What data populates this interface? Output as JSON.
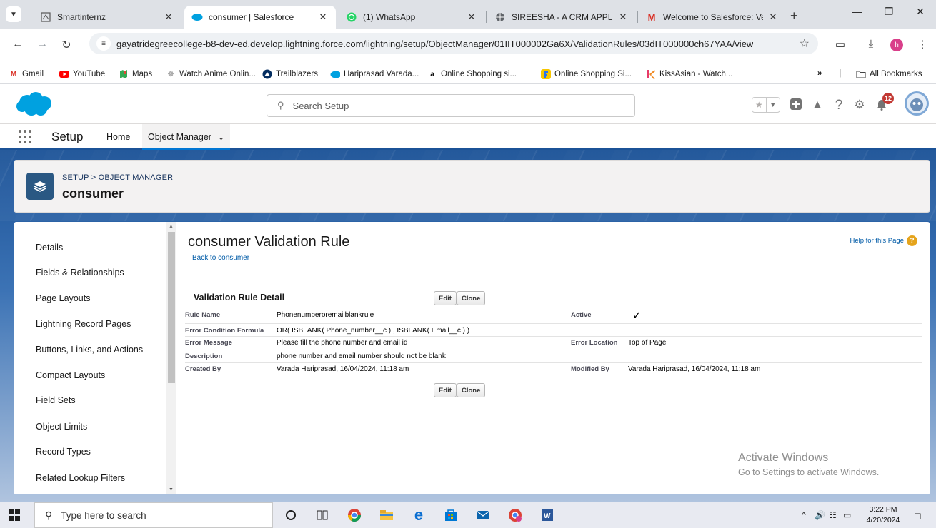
{
  "browser": {
    "tabs": [
      {
        "title": "Smartinternz",
        "active": false
      },
      {
        "title": "consumer | Salesforce",
        "active": true
      },
      {
        "title": "(1) WhatsApp",
        "active": false
      },
      {
        "title": "SIREESHA - A CRM APPLICA",
        "active": false
      },
      {
        "title": "Welcome to Salesforce: Veri",
        "active": false
      }
    ],
    "url": "gayatridegreecollege-b8-dev-ed.develop.lightning.force.com/lightning/setup/ObjectManager/01IIT000002Ga6X/ValidationRules/03dIT000000ch67YAA/view",
    "profile_initial": "h",
    "bookmarks": [
      {
        "label": "Gmail",
        "icon": "gmail-icon"
      },
      {
        "label": "YouTube",
        "icon": "youtube-icon"
      },
      {
        "label": "Maps",
        "icon": "maps-icon"
      },
      {
        "label": "Watch Anime Onlin...",
        "icon": "anime-icon"
      },
      {
        "label": "Trailblazers",
        "icon": "trailblazers-icon"
      },
      {
        "label": "Hariprasad Varada...",
        "icon": "salesforce-icon"
      },
      {
        "label": "Online Shopping si...",
        "icon": "amazon-icon"
      },
      {
        "label": "Online Shopping Si...",
        "icon": "flipkart-icon"
      },
      {
        "label": "KissAsian - Watch...",
        "icon": "kissasian-icon"
      }
    ],
    "bookmarks_more": "»",
    "all_bookmarks": "All Bookmarks"
  },
  "sf": {
    "search_placeholder": "Search Setup",
    "notification_count": "12",
    "app_name": "Setup",
    "nav": {
      "home": "Home",
      "object_manager": "Object Manager"
    },
    "breadcrumb": "SETUP > OBJECT MANAGER",
    "object_title": "consumer",
    "sidebar": [
      "Details",
      "Fields & Relationships",
      "Page Layouts",
      "Lightning Record Pages",
      "Buttons, Links, and Actions",
      "Compact Layouts",
      "Field Sets",
      "Object Limits",
      "Record Types",
      "Related Lookup Filters"
    ],
    "page_title": "consumer Validation Rule",
    "back_link": "Back to consumer",
    "help_link": "Help for this Page",
    "section_title": "Validation Rule Detail",
    "buttons": {
      "edit": "Edit",
      "clone": "Clone"
    },
    "detail": {
      "rule_name_label": "Rule Name",
      "rule_name": "Phonenumberoremailblankrule",
      "active_label": "Active",
      "active_value": "✓",
      "formula_label": "Error Condition Formula",
      "formula": "OR( ISBLANK( Phone_number__c ) , ISBLANK( Email__c ) )",
      "message_label": "Error Message",
      "message": "Please fill the phone number and email id",
      "location_label": "Error Location",
      "location": "Top of Page",
      "description_label": "Description",
      "description": "phone number and email number should not be blank",
      "created_label": "Created By",
      "created_user": "Varada Hariprasad",
      "created_date": ", 16/04/2024, 11:18 am",
      "modified_label": "Modified By",
      "modified_user": "Varada Hariprasad",
      "modified_date": ", 16/04/2024, 11:18 am"
    },
    "watermark": {
      "line1": "Activate Windows",
      "line2": "Go to Settings to activate Windows."
    }
  },
  "taskbar": {
    "search_placeholder": "Type here to search",
    "time": "3:22 PM",
    "date": "4/20/2024"
  },
  "colors": {
    "salesforce_blue": "#00a1e0",
    "nav_bar": "#1b5297",
    "link": "#015ba7",
    "object_icon": "#2a5883"
  }
}
